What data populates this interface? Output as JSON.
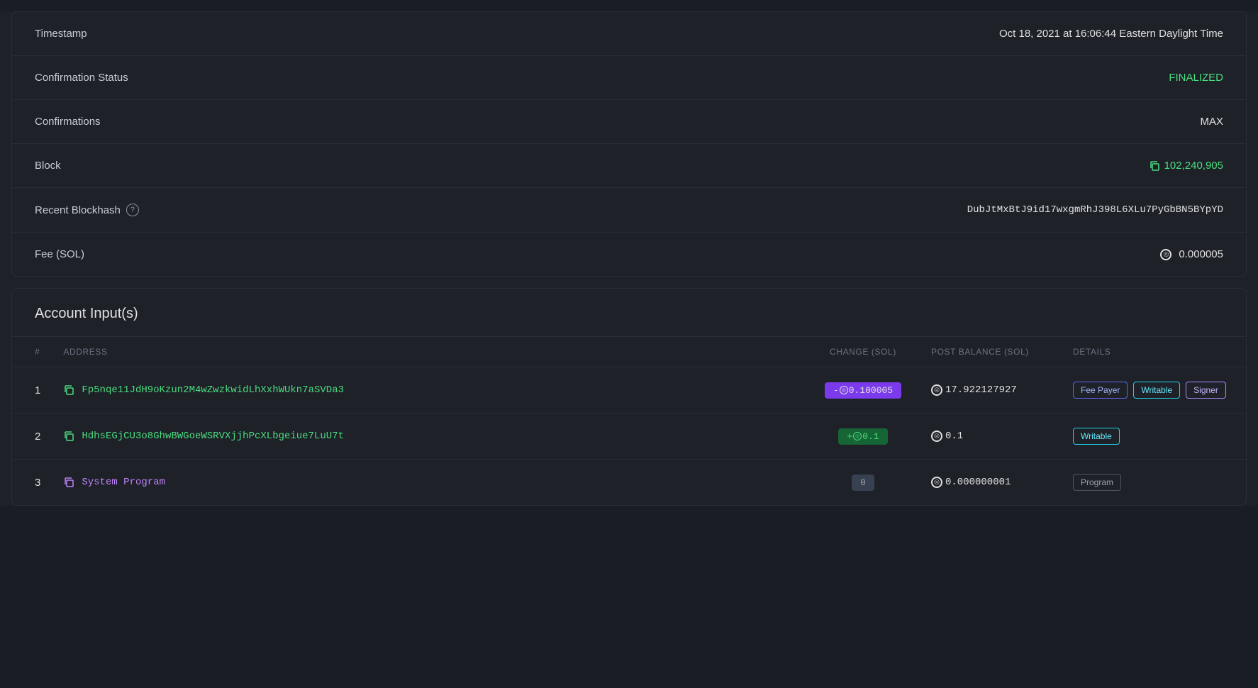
{
  "transaction": {
    "timestamp_label": "Timestamp",
    "timestamp_value": "Oct 18, 2021 at 16:06:44 Eastern Daylight Time",
    "confirmation_status_label": "Confirmation Status",
    "confirmation_status_value": "FINALIZED",
    "confirmations_label": "Confirmations",
    "confirmations_value": "MAX",
    "block_label": "Block",
    "block_value": "102,240,905",
    "recent_blockhash_label": "Recent Blockhash",
    "recent_blockhash_help": "?",
    "recent_blockhash_value": "DubJtMxBtJ9id17wxgmRhJ398L6XLu7PyGbBN5BYpYD",
    "fee_label": "Fee (SOL)",
    "fee_value": "0.000005"
  },
  "account_inputs": {
    "section_title": "Account Input(s)",
    "columns": {
      "number": "#",
      "address": "ADDRESS",
      "change": "CHANGE (SOL)",
      "post_balance": "POST BALANCE (SOL)",
      "details": "DETAILS"
    },
    "rows": [
      {
        "number": "1",
        "address": "Fp5nqe11JdH9oKzun2M4wZwzkwidLhXxhWUkn7aSVDa3",
        "address_color": "green",
        "change": "-©0.100005",
        "change_type": "negative",
        "post_balance": "17.922127927",
        "badges": [
          "Fee Payer",
          "Writable",
          "Signer"
        ]
      },
      {
        "number": "2",
        "address": "HdhsEGjCU3o8GhwBWGoeWSRVXjjhPcXLbgeiue7LuU7t",
        "address_color": "green",
        "change": "+©0.1",
        "change_type": "positive",
        "post_balance": "0.1",
        "badges": [
          "Writable"
        ]
      },
      {
        "number": "3",
        "address": "System Program",
        "address_color": "purple",
        "change": "0",
        "change_type": "zero",
        "post_balance": "0.000000001",
        "badges": [
          "Program"
        ]
      }
    ]
  },
  "colors": {
    "accent_green": "#4ade80",
    "accent_purple": "#c084fc",
    "accent_teal": "#22d3ee",
    "bg_card": "#1e2128",
    "border": "#2a2d35"
  }
}
